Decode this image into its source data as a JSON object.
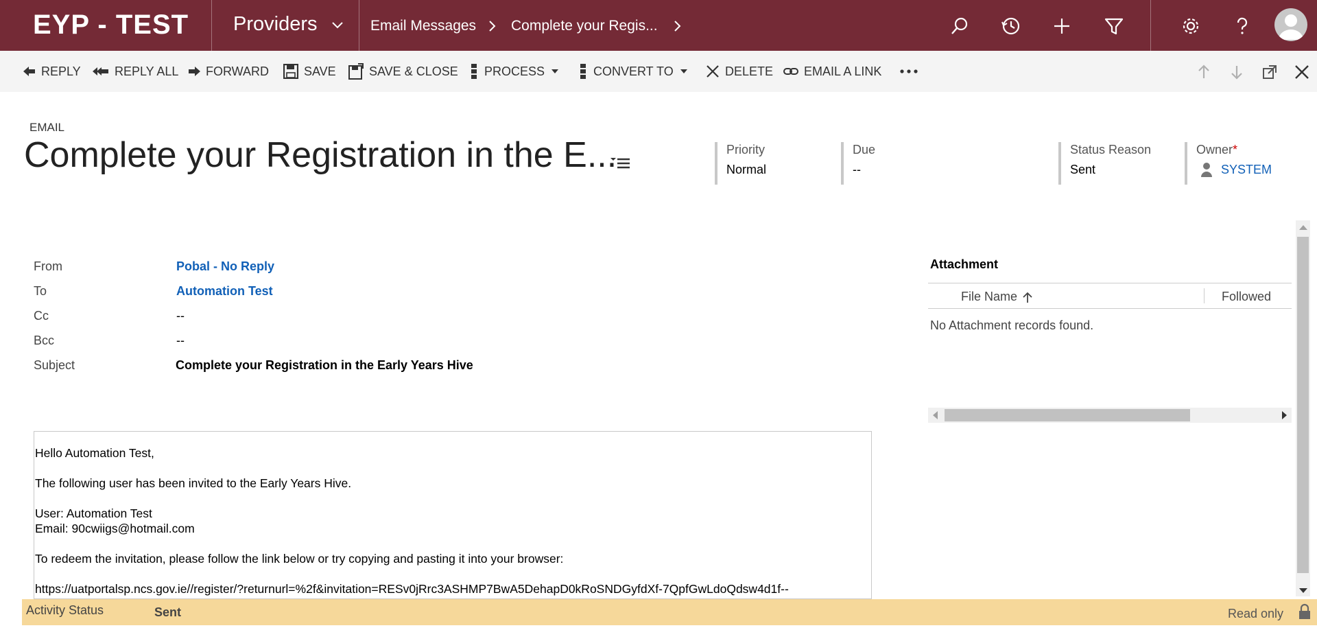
{
  "nav": {
    "brand": "EYP - TEST",
    "area": "Providers",
    "breadcrumb": [
      "Email Messages",
      "Complete your Regis..."
    ]
  },
  "commands": {
    "reply": "REPLY",
    "reply_all": "REPLY ALL",
    "forward": "FORWARD",
    "save": "SAVE",
    "save_close": "SAVE & CLOSE",
    "process": "PROCESS",
    "convert_to": "CONVERT TO",
    "delete": "DELETE",
    "email_link": "EMAIL A LINK"
  },
  "header": {
    "entity": "EMAIL",
    "title": "Complete your Registration in the E...",
    "priority_label": "Priority",
    "priority_value": "Normal",
    "due_label": "Due",
    "due_value": "--",
    "status_label": "Status Reason",
    "status_value": "Sent",
    "owner_label": "Owner",
    "owner_required": "*",
    "owner_value": "SYSTEM"
  },
  "fields": {
    "from_label": "From",
    "from_value": "Pobal - No Reply",
    "to_label": "To",
    "to_value": "Automation Test",
    "cc_label": "Cc",
    "cc_value": "--",
    "bcc_label": "Bcc",
    "bcc_value": "--",
    "subject_label": "Subject",
    "subject_value": "Complete your Registration in the Early Years Hive"
  },
  "email_body": {
    "greeting": "Hello Automation Test,",
    "line1": "The following user has been invited to the Early Years Hive.",
    "user": "User: Automation Test",
    "email": "Email: 90cwiigs@hotmail.com",
    "instruction": "To redeem the invitation, please follow the link below or try copying and pasting it into your browser:",
    "link": "https://uatportalsp.ncs.gov.ie//register/?returnurl=%2f&invitation=RESv0jRrc3ASHMP7BwA5DehapD0kRoSNDGyfdXf-7QpfGwLdoQdsw4d1f--"
  },
  "attachments": {
    "title": "Attachment",
    "col_file": "File Name",
    "col_followed": "Followed",
    "empty": "No Attachment records found."
  },
  "footer": {
    "label": "Activity Status",
    "value": "Sent",
    "readonly": "Read only"
  },
  "colors": {
    "nav_bg": "#742a36",
    "command_bg": "#f4f4f4",
    "link": "#1160b7",
    "footer_bg": "#f6d89a"
  }
}
